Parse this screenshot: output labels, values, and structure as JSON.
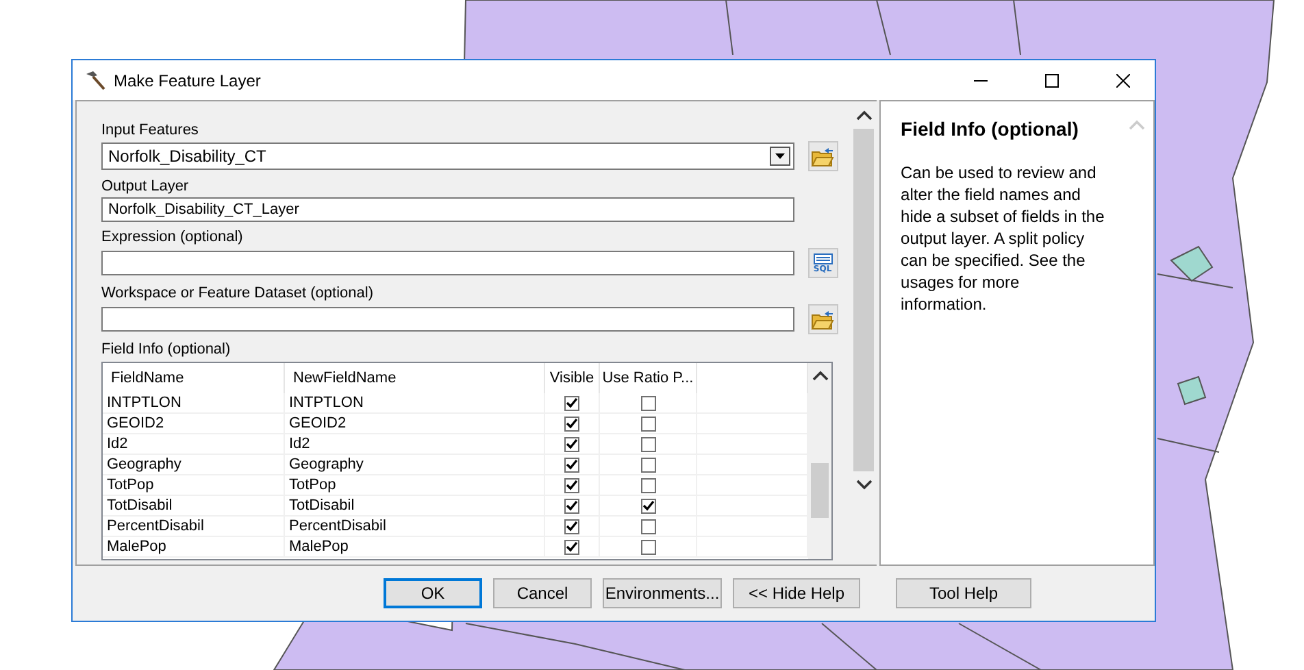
{
  "window": {
    "title": "Make Feature Layer"
  },
  "parameters": [
    {
      "kind": "dropdown",
      "label": "Input Features",
      "value": "Norfolk_Disability_CT",
      "button": {
        "kind": "folder"
      }
    },
    {
      "kind": "text",
      "label": "Output Layer",
      "value": "Norfolk_Disability_CT_Layer"
    },
    {
      "kind": "text",
      "label": "Expression (optional)",
      "button": {
        "kind": "sql",
        "label": "SQL"
      }
    },
    {
      "kind": "text",
      "label": "Workspace or Feature Dataset (optional)",
      "button": {
        "kind": "folder"
      }
    }
  ],
  "field_info": {
    "label": "Field Info (optional)",
    "columns": [
      "FieldName",
      "NewFieldName",
      "Visible",
      "Use Ratio P..."
    ],
    "rows": [
      {
        "field_name": "INTPTLON",
        "new_field_name": "INTPTLON",
        "visible": true,
        "use_ratio": false
      },
      {
        "field_name": "GEOID2",
        "new_field_name": "GEOID2",
        "visible": true,
        "use_ratio": false
      },
      {
        "field_name": "Id2",
        "new_field_name": "Id2",
        "visible": true,
        "use_ratio": false
      },
      {
        "field_name": "Geography",
        "new_field_name": "Geography",
        "visible": true,
        "use_ratio": false
      },
      {
        "field_name": "TotPop",
        "new_field_name": "TotPop",
        "visible": true,
        "use_ratio": false
      },
      {
        "field_name": "TotDisabil",
        "new_field_name": "TotDisabil",
        "visible": true,
        "use_ratio": true
      },
      {
        "field_name": "PercentDisabil",
        "new_field_name": "PercentDisabil",
        "visible": true,
        "use_ratio": false
      },
      {
        "field_name": "MalePop",
        "new_field_name": "MalePop",
        "visible": true,
        "use_ratio": false
      }
    ]
  },
  "help": {
    "title": "Field Info (optional)",
    "body": "Can be used to review and alter the field names and hide a subset of fields in the output layer. A split policy can be specified. See the usages for more information."
  },
  "buttons": [
    {
      "label": "OK",
      "default": true
    },
    {
      "label": "Cancel",
      "default": false
    },
    {
      "label": "Environments...",
      "default": false
    },
    {
      "label": "<< Hide Help",
      "default": false
    },
    {
      "label": "Tool Help",
      "default": false
    }
  ]
}
